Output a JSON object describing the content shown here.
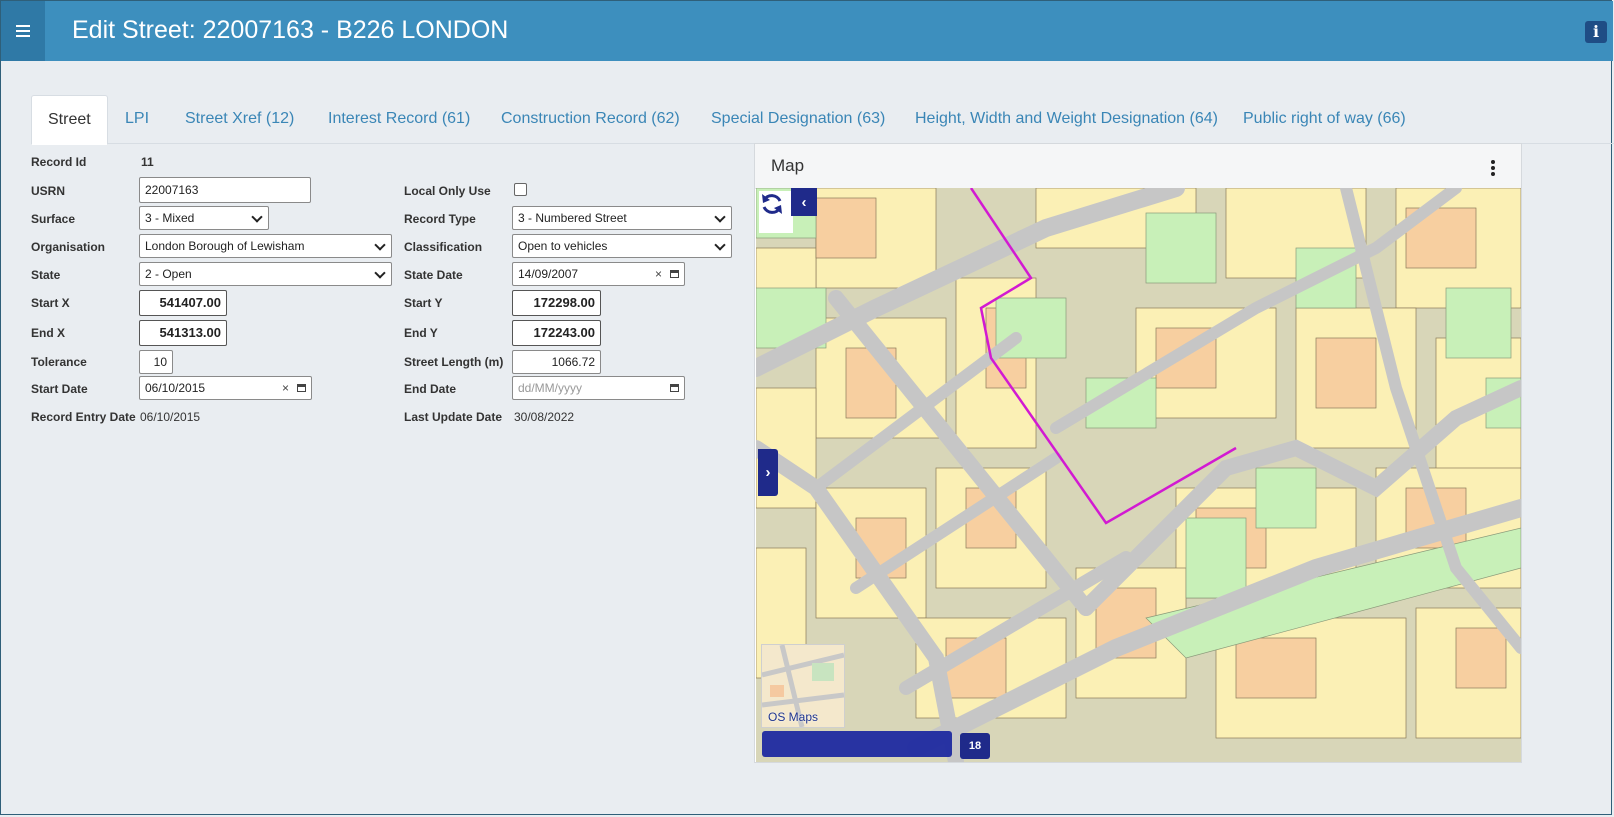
{
  "header": {
    "title": "Edit Street: 22007163 - B226 LONDON",
    "menu_icon": "hamburger-icon",
    "info_icon": "info-icon",
    "info_glyph": "i"
  },
  "tabs": [
    {
      "label": "Street",
      "active": true
    },
    {
      "label": "LPI"
    },
    {
      "label": "Street Xref (12)"
    },
    {
      "label": "Interest Record (61)"
    },
    {
      "label": "Construction Record (62)"
    },
    {
      "label": "Special Designation (63)"
    },
    {
      "label": "Height, Width and Weight Designation (64)"
    },
    {
      "label": "Public right of way (66)"
    }
  ],
  "form": {
    "record_id_label": "Record Id",
    "record_id": "11",
    "usrn_label": "USRN",
    "usrn": "22007163",
    "surface_label": "Surface",
    "surface": "3 - Mixed",
    "organisation_label": "Organisation",
    "organisation": "London Borough of Lewisham",
    "state_label": "State",
    "state": "2 - Open",
    "start_x_label": "Start X",
    "start_x": "541407.00",
    "end_x_label": "End X",
    "end_x": "541313.00",
    "tolerance_label": "Tolerance",
    "tolerance": "10",
    "start_date_label": "Start Date",
    "start_date": "06/10/2015",
    "record_entry_date_label": "Record Entry Date",
    "record_entry_date": "06/10/2015",
    "local_only_use_label": "Local Only Use",
    "local_only_use": false,
    "record_type_label": "Record Type",
    "record_type": "3 - Numbered Street",
    "classification_label": "Classification",
    "classification": "Open to vehicles",
    "state_date_label": "State Date",
    "state_date": "14/09/2007",
    "start_y_label": "Start Y",
    "start_y": "172298.00",
    "end_y_label": "End Y",
    "end_y": "172243.00",
    "street_length_label": "Street Length (m)",
    "street_length": "1066.72",
    "end_date_label": "End Date",
    "end_date_placeholder": "dd/MM/yyyy",
    "last_update_date_label": "Last Update Date",
    "last_update_date": "30/08/2022",
    "clear_glyph": "×"
  },
  "map": {
    "title": "Map",
    "basemap_label": "OS Maps",
    "zoom_level": "18",
    "collapse_glyph": "‹",
    "expand_glyph": "›",
    "colors": {
      "street_highlight": "#d21ad2",
      "building": "#fbf0b5",
      "building_alt": "#f7cfa0",
      "green": "#c8f0b8",
      "road": "#c6c6c6",
      "pavement": "#d8d6b8"
    }
  }
}
